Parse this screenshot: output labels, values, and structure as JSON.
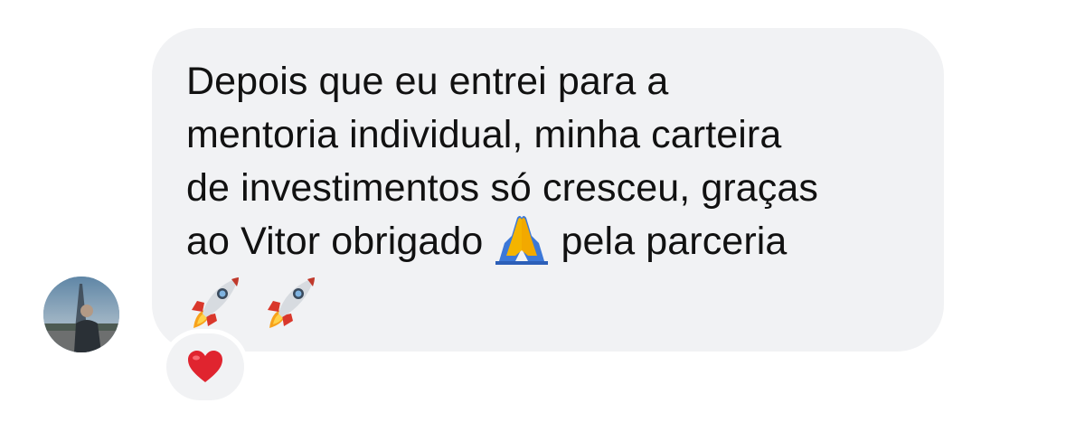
{
  "message": {
    "line_1": "Depois que eu entrei para a",
    "line_2": "mentoria individual, minha carteira",
    "line_3": "de investimentos só cresceu, graças",
    "line_4_before_emoji": "ao Vitor obrigado",
    "line_4_after_emoji": "pela parceria",
    "inline_emoji": "folded-hands-emoji",
    "trailing_emojis": [
      "rocket-emoji",
      "rocket-emoji"
    ]
  },
  "reaction": {
    "emoji": "red-heart-emoji"
  },
  "sender": {
    "avatar": "user-avatar-photo"
  },
  "colors": {
    "bubble_background": "#f1f2f4",
    "text": "#111111",
    "heart": "#e0242f",
    "page_background": "#ffffff"
  }
}
